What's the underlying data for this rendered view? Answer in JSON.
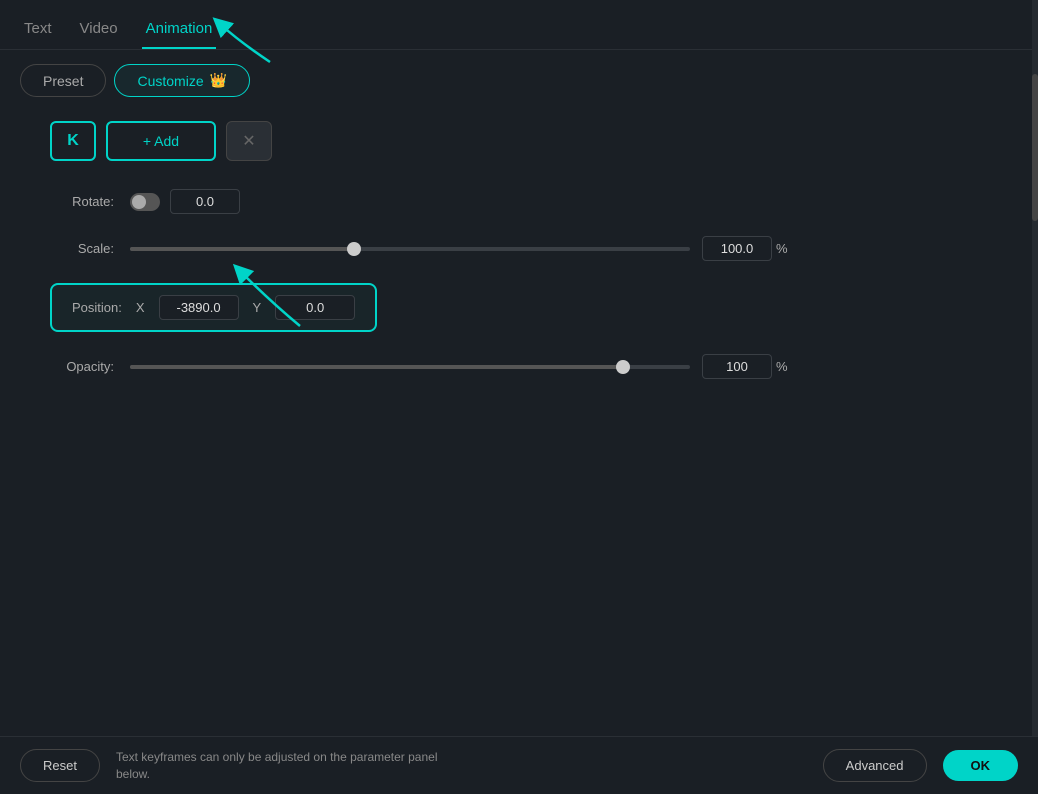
{
  "tabs": {
    "items": [
      {
        "label": "Text",
        "active": false
      },
      {
        "label": "Video",
        "active": false
      },
      {
        "label": "Animation",
        "active": true
      }
    ]
  },
  "sub_tabs": {
    "items": [
      {
        "label": "Preset",
        "active": false
      },
      {
        "label": "Customize",
        "active": true,
        "has_crown": true
      }
    ]
  },
  "buttons": {
    "k_label": "K",
    "add_label": "+ Add",
    "delete_label": "✕"
  },
  "params": {
    "rotate_label": "Rotate:",
    "rotate_value": "0.0",
    "scale_label": "Scale:",
    "scale_value": "100.0",
    "scale_percent": "%",
    "position_label": "Position:",
    "pos_x_label": "X",
    "pos_x_value": "-3890.0",
    "pos_y_label": "Y",
    "pos_y_value": "0.0",
    "opacity_label": "Opacity:",
    "opacity_value": "100",
    "opacity_percent": "%"
  },
  "bottom": {
    "reset_label": "Reset",
    "notice_text": "Text keyframes can only be adjusted on the parameter panel\nbelow.",
    "advanced_label": "Advanced",
    "ok_label": "OK"
  },
  "colors": {
    "accent": "#00d4c8",
    "bg": "#1a1f25",
    "border": "#3a3f45"
  }
}
